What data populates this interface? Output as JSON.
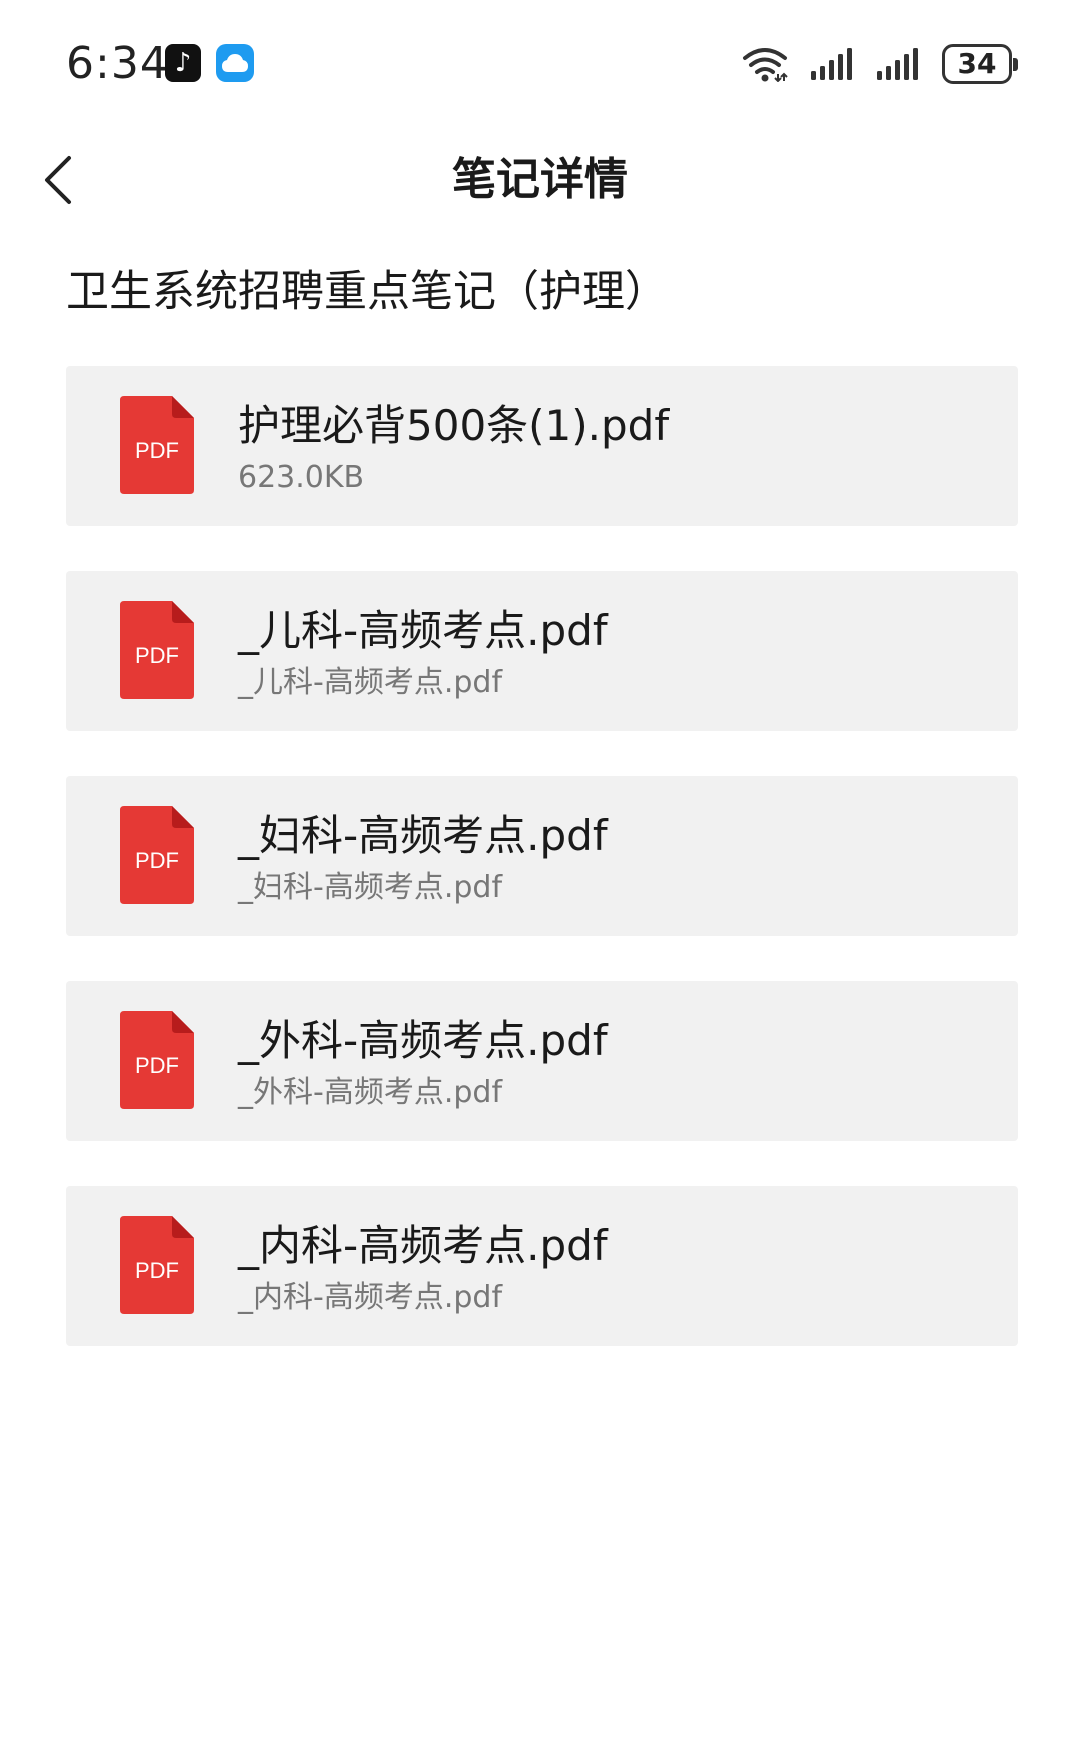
{
  "status_bar": {
    "time": "6:34",
    "battery": "34"
  },
  "header": {
    "title": "笔记详情"
  },
  "note": {
    "title": "卫生系统招聘重点笔记（护理）"
  },
  "files": [
    {
      "name": "护理必背500条(1).pdf",
      "sub": "623.0KB",
      "icon_label": "PDF"
    },
    {
      "name": "_儿科-高频考点.pdf",
      "sub": "_儿科-高频考点.pdf",
      "icon_label": "PDF"
    },
    {
      "name": "_妇科-高频考点.pdf",
      "sub": "_妇科-高频考点.pdf",
      "icon_label": "PDF"
    },
    {
      "name": "_外科-高频考点.pdf",
      "sub": "_外科-高频考点.pdf",
      "icon_label": "PDF"
    },
    {
      "name": "_内科-高频考点.pdf",
      "sub": "_内科-高频考点.pdf",
      "icon_label": "PDF"
    }
  ],
  "colors": {
    "pdf_red": "#e53935",
    "pdf_fold": "#b71c1c",
    "card_bg": "#f1f1f1"
  }
}
